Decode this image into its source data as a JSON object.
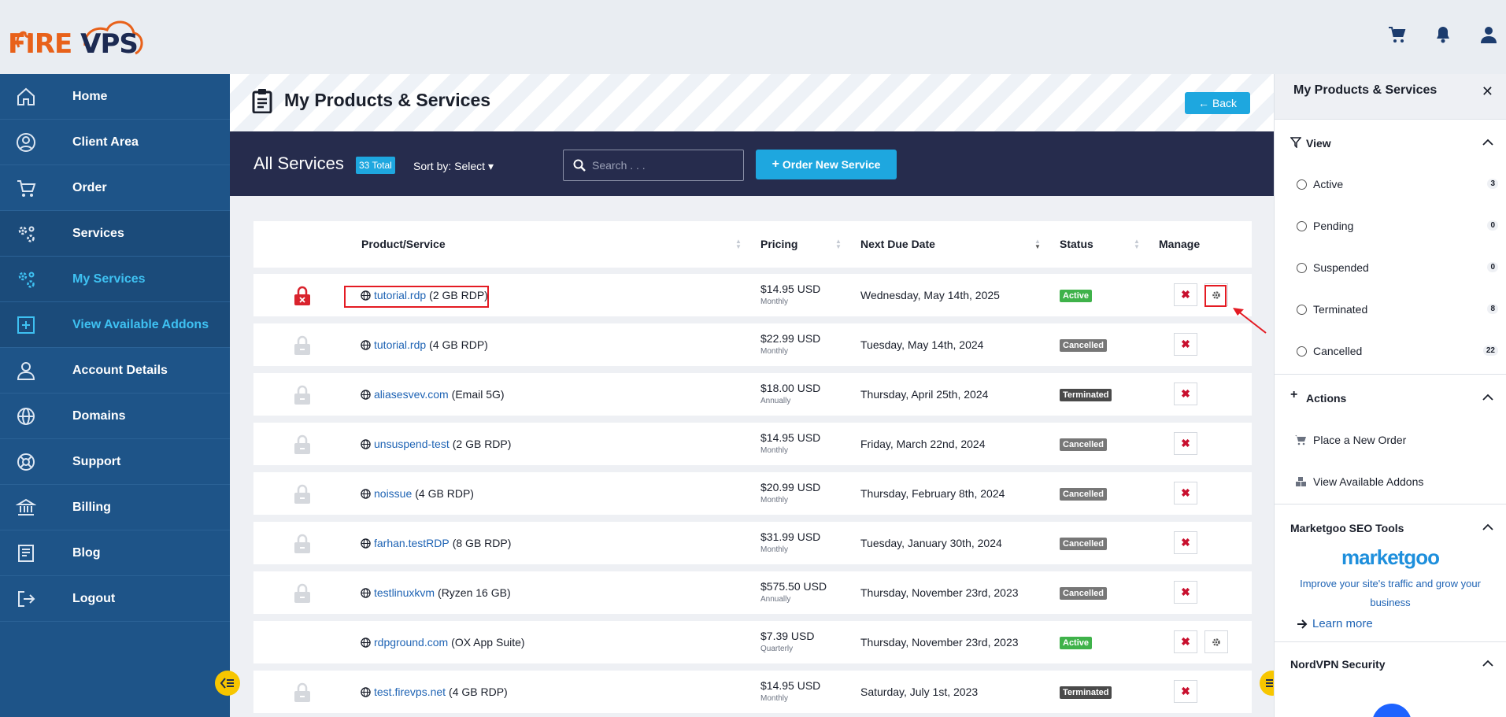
{
  "logo": {
    "part1": "FIRE",
    "part2": "VPS"
  },
  "topbar": {
    "icons": [
      "cart-icon",
      "bell-icon",
      "user-icon"
    ]
  },
  "sidebar": {
    "items": [
      {
        "label": "Home",
        "icon": "home-icon"
      },
      {
        "label": "Client Area",
        "icon": "user-circle-icon"
      },
      {
        "label": "Order",
        "icon": "cart-icon"
      },
      {
        "label": "Services",
        "icon": "gears-icon"
      },
      {
        "label": "My Services",
        "icon": "gears-icon"
      },
      {
        "label": "View Available Addons",
        "icon": "plus-square-icon"
      },
      {
        "label": "Account Details",
        "icon": "user-icon"
      },
      {
        "label": "Domains",
        "icon": "globe-icon"
      },
      {
        "label": "Support",
        "icon": "lifering-icon"
      },
      {
        "label": "Billing",
        "icon": "bank-icon"
      },
      {
        "label": "Blog",
        "icon": "book-icon"
      },
      {
        "label": "Logout",
        "icon": "logout-icon"
      }
    ]
  },
  "page": {
    "title": "My Products & Services",
    "back_label": "Back"
  },
  "services_bar": {
    "title": "All Services",
    "total": "33 Total",
    "sort_label": "Sort by: Select",
    "search_placeholder": "Search . . .",
    "order_label": "Order New Service"
  },
  "table": {
    "headers": [
      "Product/Service",
      "Pricing",
      "Next Due Date",
      "Status",
      "Manage"
    ],
    "rows": [
      {
        "domain": "tutorial.rdp",
        "product": "(2 GB RDP)",
        "price": "$14.95 USD",
        "cycle": "Monthly",
        "due": "Wednesday, May 14th, 2025",
        "status": "Active",
        "lock": "locked-red",
        "gear": true
      },
      {
        "domain": "tutorial.rdp",
        "product": "(4 GB RDP)",
        "price": "$22.99 USD",
        "cycle": "Monthly",
        "due": "Tuesday, May 14th, 2024",
        "status": "Cancelled",
        "lock": "locked-grey",
        "gear": false
      },
      {
        "domain": "aliasesvev.com",
        "product": "(Email 5G)",
        "price": "$18.00 USD",
        "cycle": "Annually",
        "due": "Thursday, April 25th, 2024",
        "status": "Terminated",
        "lock": "locked-grey",
        "gear": false
      },
      {
        "domain": "unsuspend-test",
        "product": "(2 GB RDP)",
        "price": "$14.95 USD",
        "cycle": "Monthly",
        "due": "Friday, March 22nd, 2024",
        "status": "Cancelled",
        "lock": "locked-grey",
        "gear": false
      },
      {
        "domain": "noissue",
        "product": "(4 GB RDP)",
        "price": "$20.99 USD",
        "cycle": "Monthly",
        "due": "Thursday, February 8th, 2024",
        "status": "Cancelled",
        "lock": "locked-grey",
        "gear": false
      },
      {
        "domain": "farhan.testRDP",
        "product": "(8 GB RDP)",
        "price": "$31.99 USD",
        "cycle": "Monthly",
        "due": "Tuesday, January 30th, 2024",
        "status": "Cancelled",
        "lock": "locked-grey",
        "gear": false
      },
      {
        "domain": "testlinuxkvm",
        "product": "(Ryzen 16 GB)",
        "price": "$575.50 USD",
        "cycle": "Annually",
        "due": "Thursday, November 23rd, 2023",
        "status": "Cancelled",
        "lock": "locked-grey",
        "gear": false
      },
      {
        "domain": "rdpground.com",
        "product": "(OX App Suite)",
        "price": "$7.39 USD",
        "cycle": "Quarterly",
        "due": "Thursday, November 23rd, 2023",
        "status": "Active",
        "lock": "none",
        "gear": true
      },
      {
        "domain": "test.firevps.net",
        "product": "(4 GB RDP)",
        "price": "$14.95 USD",
        "cycle": "Monthly",
        "due": "Saturday, July 1st, 2023",
        "status": "Terminated",
        "lock": "locked-grey",
        "gear": false
      }
    ]
  },
  "right_panel": {
    "title": "My Products & Services",
    "view_title": "View",
    "filters": [
      {
        "label": "Active",
        "count": "3"
      },
      {
        "label": "Pending",
        "count": "0"
      },
      {
        "label": "Suspended",
        "count": "0"
      },
      {
        "label": "Terminated",
        "count": "8"
      },
      {
        "label": "Cancelled",
        "count": "22"
      }
    ],
    "actions_title": "Actions",
    "actions": [
      {
        "label": "Place a New Order",
        "icon": "cart-icon"
      },
      {
        "label": "View Available Addons",
        "icon": "cubes-icon"
      }
    ],
    "marketgoo_title": "Marketgoo SEO Tools",
    "marketgoo_logo": "marketgoo",
    "marketgoo_text": "Improve your site's traffic and grow your business",
    "learn_more": "Learn more",
    "nord_title": "NordVPN Security"
  },
  "colors": {
    "sidebar": "#1e5488",
    "accent": "#1ea7df",
    "bar": "#262c4d",
    "active": "#3fb24a"
  }
}
